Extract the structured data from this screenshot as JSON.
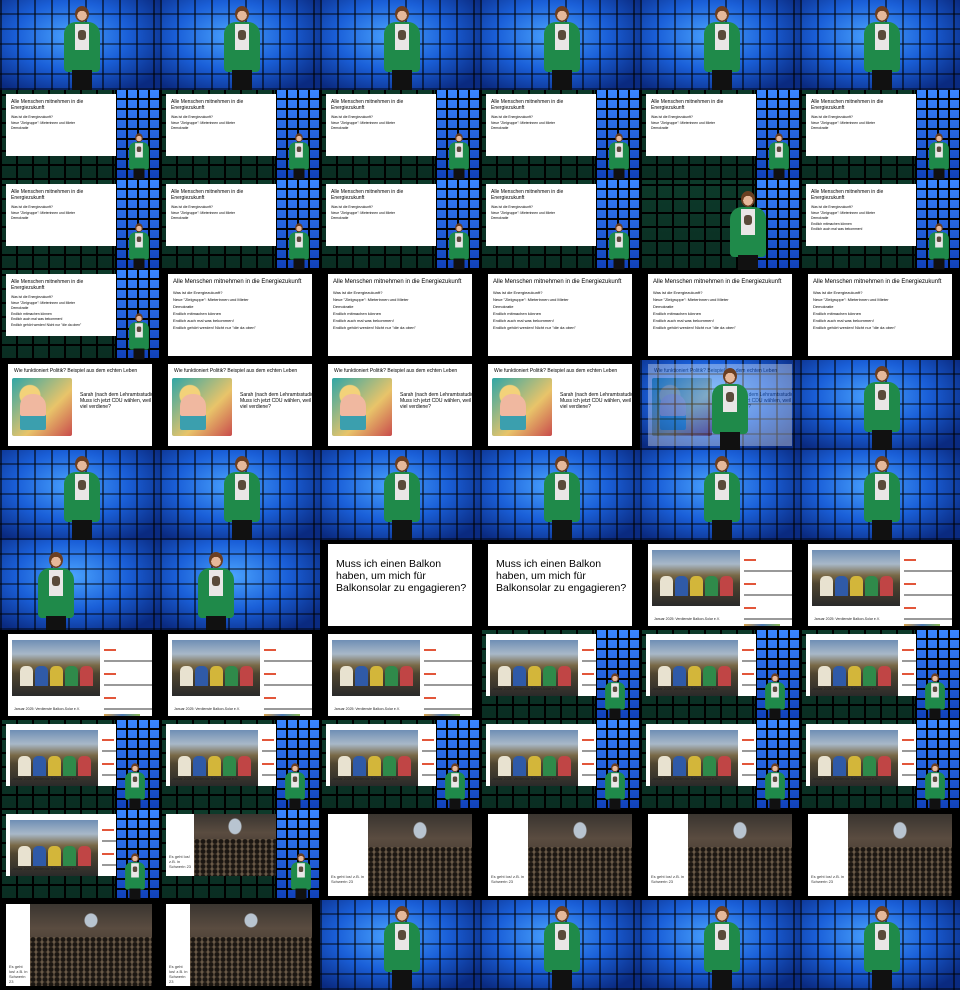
{
  "slides": {
    "agenda": {
      "title": "Alle Menschen mitnehmen in die Energiezukunft",
      "items": [
        "Was ist die Energiezukunft?",
        "Neue \"Zielgruppe\": Mieterinnen und Mieter",
        "Demokratie",
        "Endlich mitmachen können",
        "Endlich auch mal was bekommen!",
        "Endlich gehört werden! Nicht nur \"die da oben\""
      ]
    },
    "politics": {
      "title": "Wie funktioniert Politik? Beispiel aus dem echten Leben",
      "person": "Sarah (nach dem Lehramtsstudium)",
      "question": "Muss ich jetzt CDU wählen, weil ich viel verdiene?"
    },
    "balkon": {
      "question": "Muss ich einen Balkon haben, um mich für Balkonsolar zu engagieren?"
    },
    "photo": {
      "caption": "Januar 2025: Verdienste Balkon-Solar e.V."
    },
    "hall": {
      "caption": "Es geht los! z.B. in Schwerin 23"
    }
  },
  "cells": [
    "speaker",
    "speaker",
    "speaker",
    "speaker",
    "speaker",
    "speaker",
    "agenda3-small",
    "agenda3-small",
    "agenda3-small",
    "agenda3-small",
    "agenda3-small",
    "agenda3-small",
    "agenda3-small",
    "agenda3-small",
    "agenda3-small",
    "agenda3-small",
    "speaker-green",
    "agenda5-small",
    "agenda6-small",
    "agenda6-big",
    "agenda6-big",
    "agenda6-big",
    "agenda6-big",
    "agenda6-big",
    "politics",
    "politics",
    "politics",
    "politics",
    "politics-fade",
    "speaker",
    "speaker",
    "speaker",
    "speaker",
    "speaker",
    "speaker",
    "speaker",
    "speaker-left",
    "speaker-left",
    "balkon",
    "balkon",
    "photo",
    "photo",
    "photo",
    "photo",
    "photo",
    "photo-small",
    "photo-small",
    "photo-small",
    "photo-small",
    "photo-small",
    "photo-small",
    "photo-small",
    "photo-small",
    "photo-small",
    "photo-small",
    "hall-small",
    "hall",
    "hall",
    "hall",
    "hall",
    "hall-left",
    "hall-left",
    "speaker",
    "speaker",
    "speaker",
    "speaker"
  ]
}
